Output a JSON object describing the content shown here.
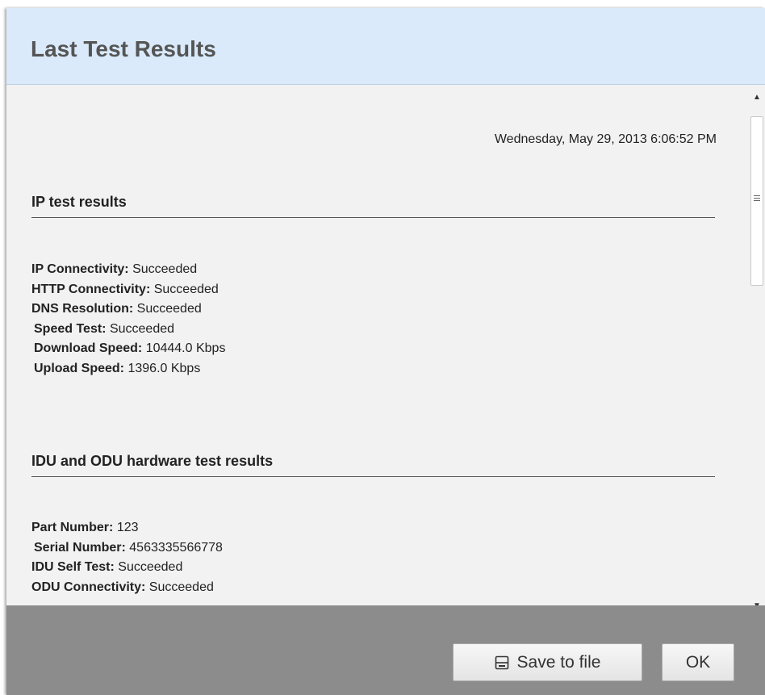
{
  "dialog": {
    "title": "Last Test Results",
    "timestamp": "Wednesday, May 29, 2013 6:06:52 PM"
  },
  "sections": [
    {
      "title": "IP test results",
      "rows": [
        {
          "label": "IP Connectivity:",
          "value": "Succeeded"
        },
        {
          "label": "HTTP Connectivity:",
          "value": "Succeeded"
        },
        {
          "label": "DNS Resolution:",
          "value": "Succeeded"
        },
        {
          "label": "Speed Test:",
          "value": "Succeeded"
        },
        {
          "label": "Download Speed:",
          "value": "10444.0 Kbps"
        },
        {
          "label": "Upload Speed:",
          "value": "1396.0 Kbps"
        }
      ]
    },
    {
      "title": "IDU and ODU hardware test results",
      "rows": [
        {
          "label": "Part Number:",
          "value": "123"
        },
        {
          "label": "Serial Number:",
          "value": "4563335566778"
        },
        {
          "label": "IDU Self Test:",
          "value": "Succeeded"
        },
        {
          "label": "ODU Connectivity:",
          "value": "Succeeded"
        }
      ]
    }
  ],
  "footer": {
    "save_label": "Save to file",
    "ok_label": "OK",
    "save_icon": "save-icon"
  }
}
